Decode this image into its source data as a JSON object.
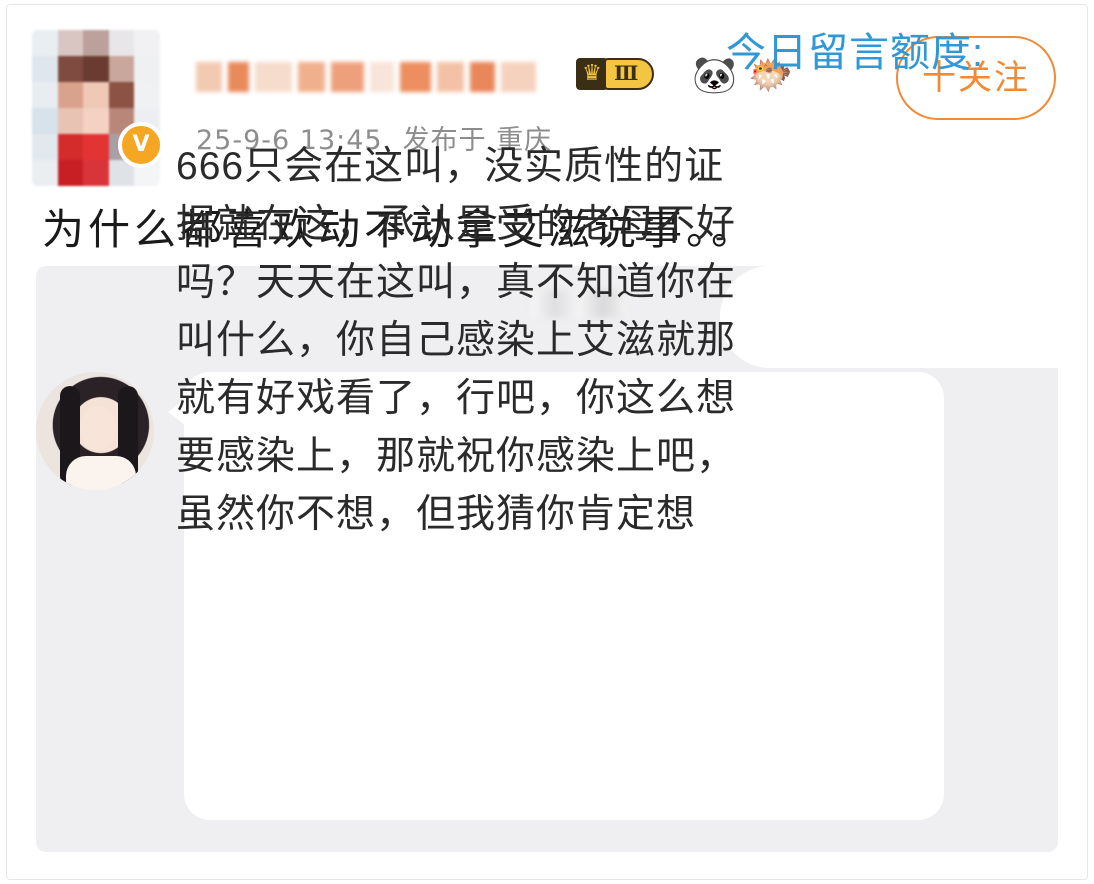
{
  "post": {
    "author_name": "",
    "timestamp": "25-9-6 13:45",
    "location": "发布于 重庆",
    "follow_label": "十关注",
    "level_label": "Ⅲ",
    "verify_mark": "V",
    "badges": [
      "crown-level-badge",
      "panda-icon",
      "pufferfish-icon"
    ],
    "content": "为什么都喜欢动不动拿艾滋说事。。"
  },
  "embedded_screenshot": {
    "quota_label": "今日留言额度:",
    "comment_text": "666只会在这叫，没实质性的证\n据就在这，承认是受的老母不好\n吗？天天在这叫，真不知道你在\n叫什么，你自己感染上艾滋就那\n就有好戏看了，行吧，你这么想\n要感染上，那就祝你感染上吧，\n虽然你不想，但我猜你肯定想"
  },
  "colors": {
    "accent": "#f08a37",
    "quota_blue": "#2f98d6",
    "embed_bg": "#efeff1",
    "meta_gray": "#8d8d8d",
    "verify_gold": "#f5a623"
  }
}
